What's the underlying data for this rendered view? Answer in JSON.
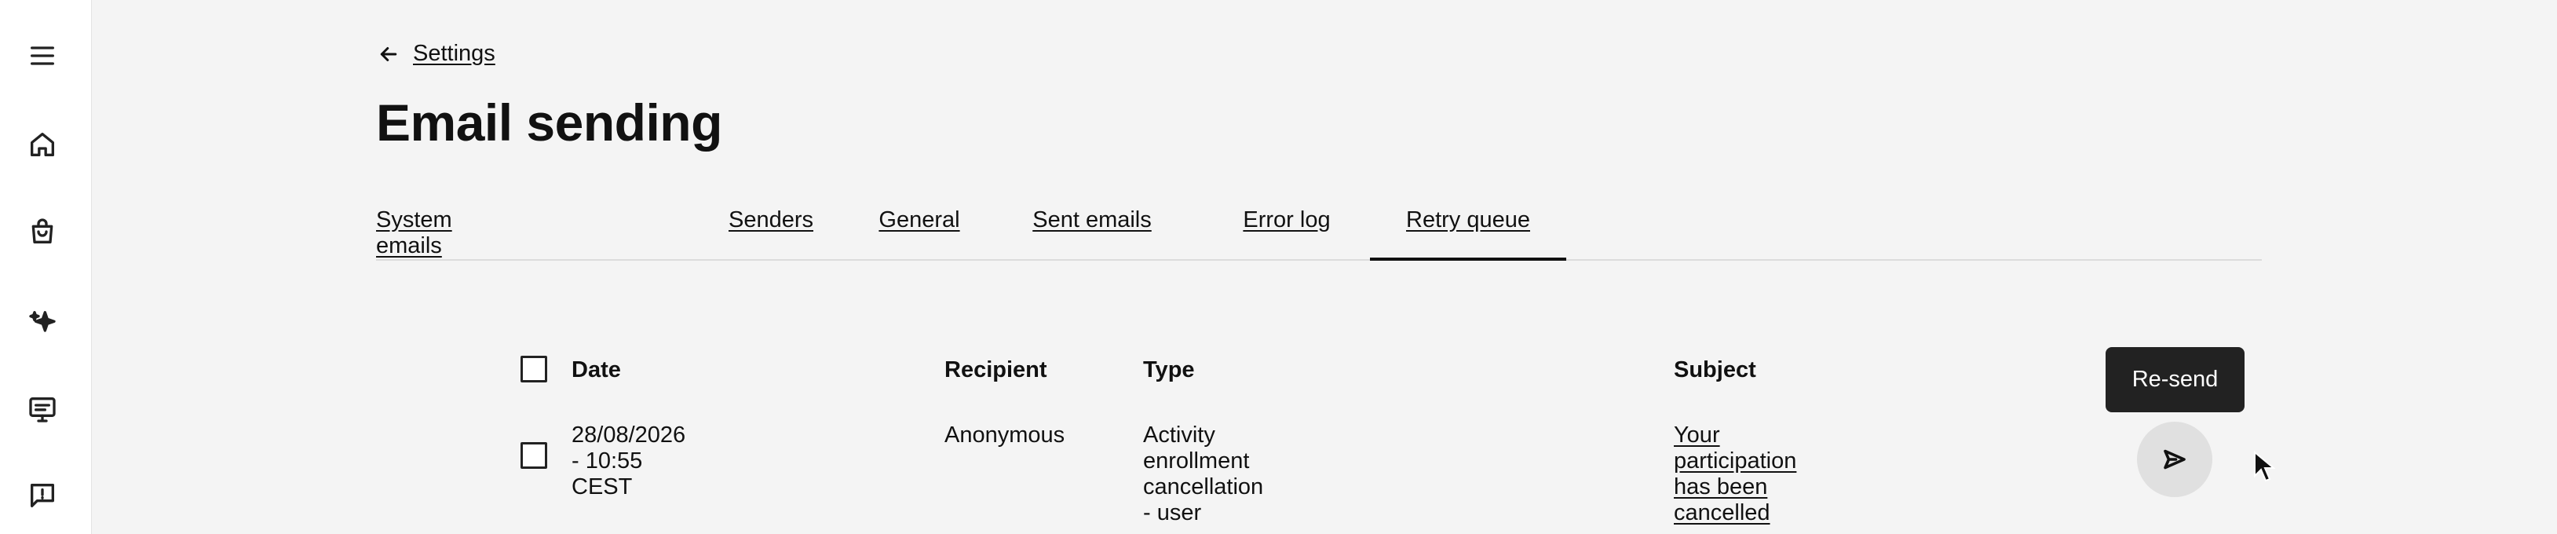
{
  "sidebar": {
    "items": [
      {
        "icon": "menu-icon"
      },
      {
        "icon": "home-icon"
      },
      {
        "icon": "shopping-bag-icon"
      },
      {
        "icon": "sparkles-icon"
      },
      {
        "icon": "display-list-icon"
      },
      {
        "icon": "feedback-icon"
      }
    ]
  },
  "breadcrumb": {
    "back_icon": "arrow-left-icon",
    "label": "Settings"
  },
  "page": {
    "title": "Email sending"
  },
  "tabs": [
    {
      "label": "System emails",
      "active": false
    },
    {
      "label": "Senders",
      "active": false
    },
    {
      "label": "General",
      "active": false
    },
    {
      "label": "Sent emails",
      "active": false
    },
    {
      "label": "Error log",
      "active": false
    },
    {
      "label": "Retry queue",
      "active": true
    }
  ],
  "table": {
    "columns": [
      "Date",
      "Recipient",
      "Type",
      "Subject"
    ],
    "rows": [
      {
        "date": "28/08/2026 - 10:55 CEST",
        "recipient": "Anonymous",
        "type": "Activity enrollment cancellation - user",
        "subject": "Your participation has been cancelled"
      }
    ]
  },
  "actions": {
    "resend_tooltip": "Re-send",
    "resend_icon": "send-icon"
  }
}
